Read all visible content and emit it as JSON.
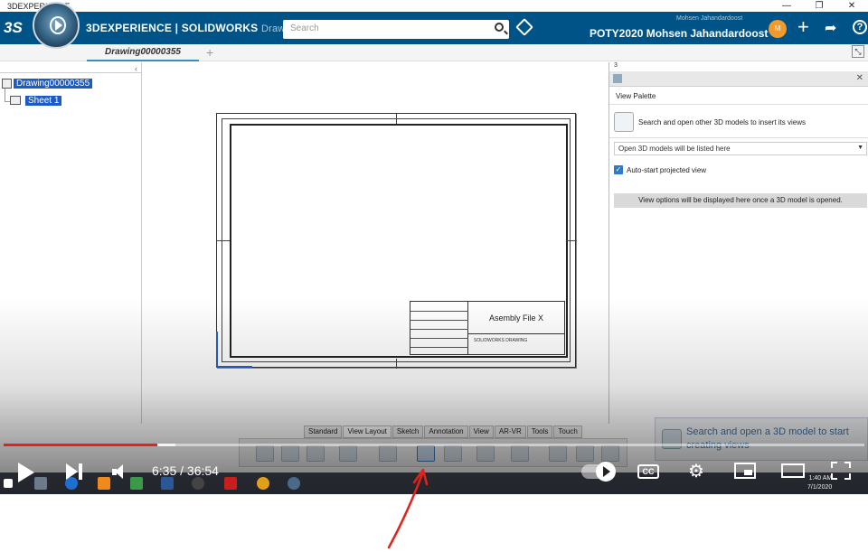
{
  "window": {
    "title": "3DEXPERIENCE",
    "controls": [
      "—",
      "❐",
      "✕"
    ]
  },
  "app": {
    "brand_bold": "3DEXPERIENCE | SOLIDWORKS",
    "brand_light": "Drawings",
    "search_placeholder": "Search",
    "user_small": "Mohsen Jahandardoost",
    "user": "POTY2020 Mohsen Jahandardoost ⌄",
    "avatar_initials": "M"
  },
  "tabs": {
    "active": "Drawing00000355",
    "add": "+"
  },
  "tree": {
    "collapse": "‹",
    "root": "Drawing00000355",
    "child": "Sheet 1"
  },
  "drawing": {
    "title_block_title": "Asembly File X",
    "title_block_sub": "SOLIDWORKS  DRAWING"
  },
  "palette": {
    "panel_number": "3",
    "title": "View Palette",
    "search_text": "Search and open other 3D models to insert its views",
    "dropdown": "Open 3D models will be listed here",
    "auto_start_label": "Auto-start projected view",
    "info": "View options will be displayed here once a 3D model is opened."
  },
  "command_tabs": [
    "Standard",
    "View Layout",
    "Sketch",
    "Annotation",
    "View",
    "AR-VR",
    "Tools",
    "Touch"
  ],
  "command_tabs_active": "View Layout",
  "toast": {
    "text": "Search and open a 3D model to start creating views"
  },
  "player": {
    "time": "6:35 / 36:54",
    "progress_fraction": 0.179,
    "buffer_fraction": 0.2,
    "cc": "CC"
  },
  "taskbar": {
    "time": "1:40 AM",
    "date": "7/1/2020"
  },
  "colors": {
    "header": "#005386",
    "progress": "#e2221c",
    "selection": "#1a5bc6",
    "annotation_arrow": "#e2221c"
  }
}
